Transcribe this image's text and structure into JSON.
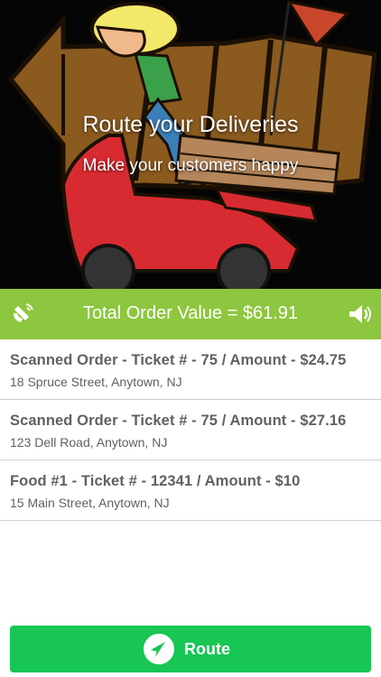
{
  "hero": {
    "title": "Route your Deliveries",
    "subtitle": "Make your customers happy"
  },
  "total_bar": {
    "text": "Total Order Value = $61.91",
    "left_icon": "scan-icon",
    "right_icon": "speaker-icon",
    "color": "#8dc63f"
  },
  "orders": [
    {
      "title": "Scanned Order - Ticket # - 75 / Amount - $24.75",
      "address": "18 Spruce Street,  Anytown, NJ"
    },
    {
      "title": "Scanned Order - Ticket # - 75 / Amount - $27.16",
      "address": "123 Dell Road, Anytown, NJ"
    },
    {
      "title": "Food #1 - Ticket # - 12341 / Amount - $10",
      "address": "15 Main Street, Anytown, NJ"
    }
  ],
  "route_button": {
    "label": "Route",
    "icon": "navigation-arrow-icon",
    "color": "#17c653"
  }
}
